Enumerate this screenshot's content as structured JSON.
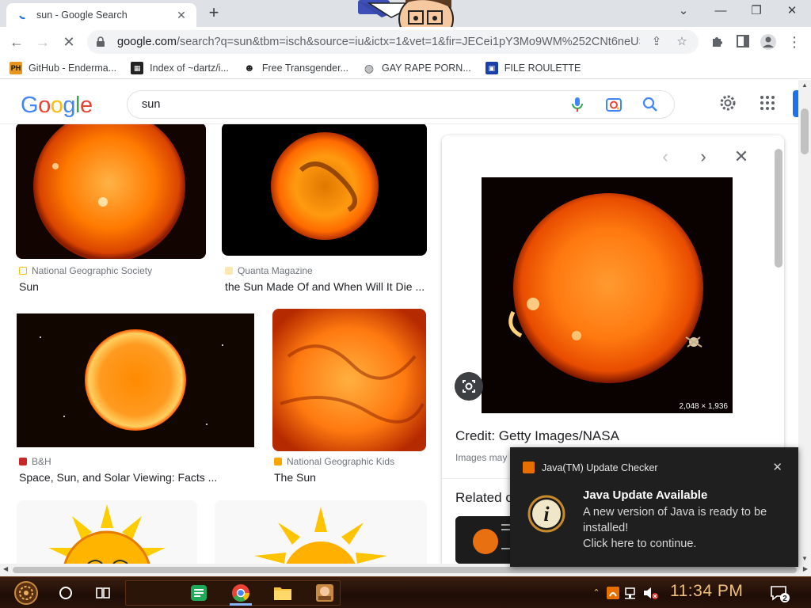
{
  "browser": {
    "tab_title": "sun - Google Search",
    "url_main": "google.com",
    "url_rest": "/search?q=sun&tbm=isch&source=iu&ictx=1&vet=1&fir=JECei1pY3Mo9WM%252CNt6neUS...",
    "bookmarks": [
      {
        "label": "GitHub - Enderma...",
        "icon": "ph-icon"
      },
      {
        "label": "Index of ~dartz/i...",
        "icon": "terminal-icon"
      },
      {
        "label": "Free Transgender...",
        "icon": "mask-icon"
      },
      {
        "label": "GAY RAPE PORN...",
        "icon": "globe-icon"
      },
      {
        "label": "FILE ROULETTE",
        "icon": "floppy-icon"
      }
    ]
  },
  "google": {
    "logo": "Google",
    "query": "sun"
  },
  "results": [
    {
      "source": "National Geographic Society",
      "title": "Sun",
      "source_color": "#f6c000"
    },
    {
      "source": "Quanta Magazine",
      "title": "the Sun Made Of and When Will It Die ...",
      "source_color": "#e8a800"
    },
    {
      "source": "B&H",
      "title": "Space, Sun, and Solar Viewing: Facts ...",
      "source_color": "#c62828"
    },
    {
      "source": "National Geographic Kids",
      "title": "The Sun",
      "source_color": "#f6a800"
    }
  ],
  "preview": {
    "dimensions": "2,048 × 1,936",
    "credit": "Credit: Getty Images/NASA",
    "copyright": "Images may",
    "related": "Related c"
  },
  "toast": {
    "app": "Java(TM) Update Checker",
    "title": "Java Update Available",
    "body_line1": "A new version of Java is ready to be installed!",
    "body_line2": "Click here to continue."
  },
  "taskbar": {
    "clock": "11:34 PM",
    "notification_count": "2"
  },
  "colors": {
    "accent": "#1a73e8",
    "sun_core": "#ff7a00",
    "clock": "#f0c178"
  }
}
